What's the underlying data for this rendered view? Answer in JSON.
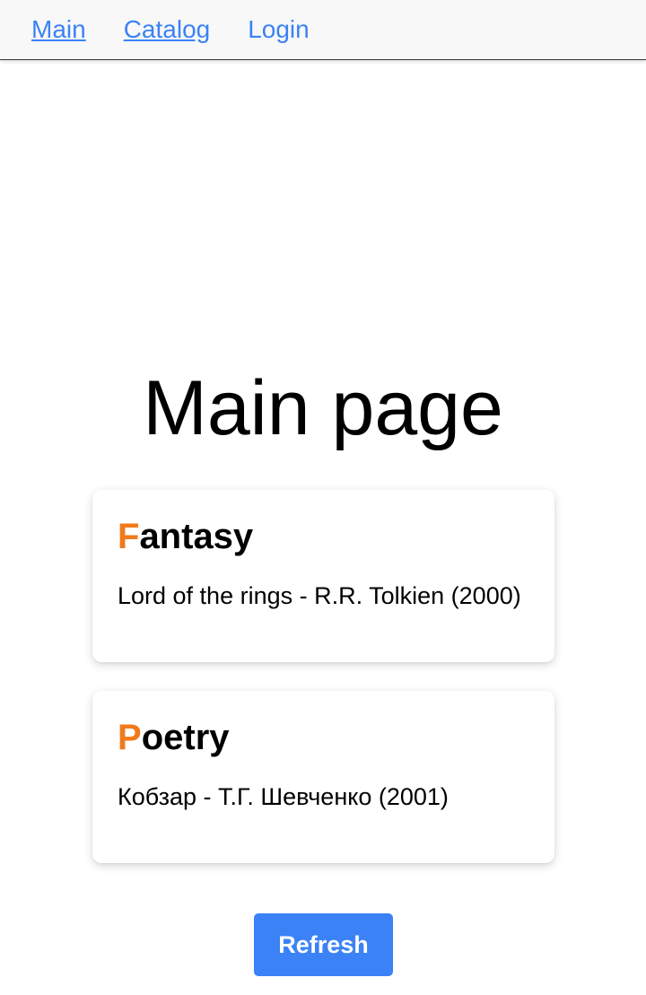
{
  "nav": {
    "items": [
      {
        "label": "Main"
      },
      {
        "label": "Catalog"
      },
      {
        "label": "Login"
      }
    ]
  },
  "main": {
    "title": "Main page",
    "cards": [
      {
        "initial": "F",
        "rest": "antasy",
        "book": "Lord of the rings - R.R. Tolkien (2000)"
      },
      {
        "initial": "P",
        "rest": "oetry",
        "book": "Кобзар - Т.Г. Шевченко (2001)"
      }
    ],
    "refresh_label": "Refresh"
  },
  "colors": {
    "link": "#3b82f6",
    "accent": "#f07a1c",
    "button": "#3b82f6"
  }
}
